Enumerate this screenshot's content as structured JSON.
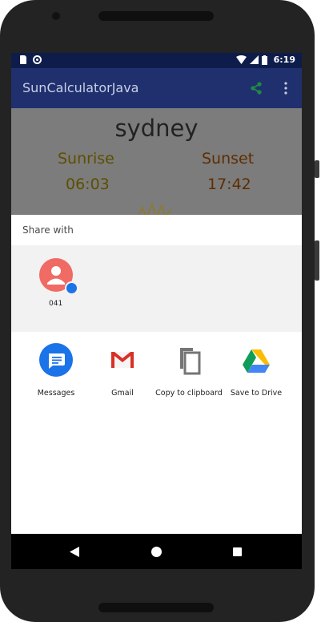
{
  "status_bar": {
    "time": "6:19"
  },
  "app_bar": {
    "title": "SunCalculatorJava",
    "share_icon": "share-icon",
    "overflow_icon": "more-vert-icon"
  },
  "content": {
    "city": "sydney",
    "sunrise_label": "Sunrise",
    "sunrise_time": "06:03",
    "sunset_label": "Sunset",
    "sunset_time": "17:42"
  },
  "share_sheet": {
    "title": "Share with",
    "direct_contact": {
      "label": "041"
    },
    "apps": [
      {
        "label": "Messages",
        "icon": "messages-icon"
      },
      {
        "label": "Gmail",
        "icon": "gmail-icon"
      },
      {
        "label": "Copy to clipboard",
        "icon": "copy-icon"
      },
      {
        "label": "Save to Drive",
        "icon": "drive-icon"
      }
    ]
  },
  "colors": {
    "status_bar": "#0d1c4a",
    "app_bar": "#20306f",
    "share_accent": "#1e8c45",
    "sunrise": "#5c4f00",
    "sunset": "#5e2d00"
  }
}
